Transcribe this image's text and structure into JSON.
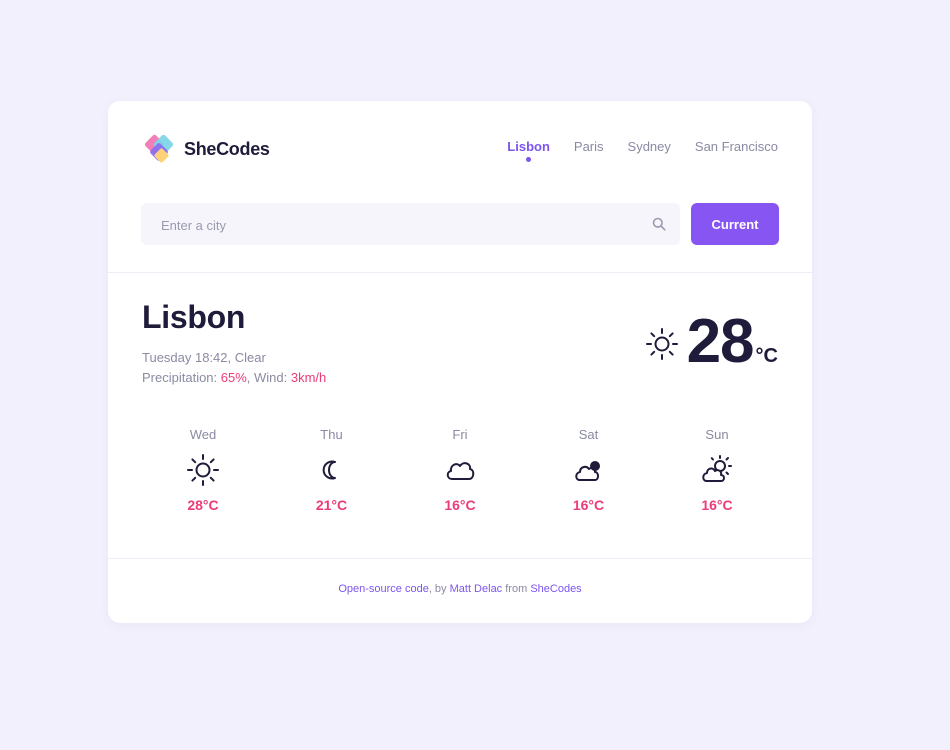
{
  "brand": {
    "name": "SheCodes"
  },
  "nav": {
    "items": [
      {
        "label": "Lisbon",
        "active": true
      },
      {
        "label": "Paris",
        "active": false
      },
      {
        "label": "Sydney",
        "active": false
      },
      {
        "label": "San Francisco",
        "active": false
      }
    ]
  },
  "search": {
    "placeholder": "Enter a city",
    "value": "",
    "button_label": "Current"
  },
  "current": {
    "city": "Lisbon",
    "day_time": "Tuesday 18:42",
    "condition": "Clear",
    "precipitation_label": "Precipitation: ",
    "precipitation": "65%",
    "wind_label": ", Wind: ",
    "wind": "3km/h",
    "temperature": "28",
    "unit": "°C",
    "icon": "sun-icon"
  },
  "forecast": [
    {
      "day": "Wed",
      "temp": "28°C",
      "icon": "sun-icon"
    },
    {
      "day": "Thu",
      "temp": "21°C",
      "icon": "moon-icon"
    },
    {
      "day": "Fri",
      "temp": "16°C",
      "icon": "cloud-icon"
    },
    {
      "day": "Sat",
      "temp": "16°C",
      "icon": "cloud-rain-icon"
    },
    {
      "day": "Sun",
      "temp": "16°C",
      "icon": "partly-cloudy-icon"
    }
  ],
  "footer": {
    "link1": "Open-source code",
    "text1": ", by ",
    "link2": "Matt Delac",
    "text2": " from ",
    "link3": "SheCodes"
  },
  "colors": {
    "accent": "#8756f2",
    "highlight": "#ec3b7a",
    "background": "#f3f0fd",
    "text_dark": "#1e1c3a"
  }
}
